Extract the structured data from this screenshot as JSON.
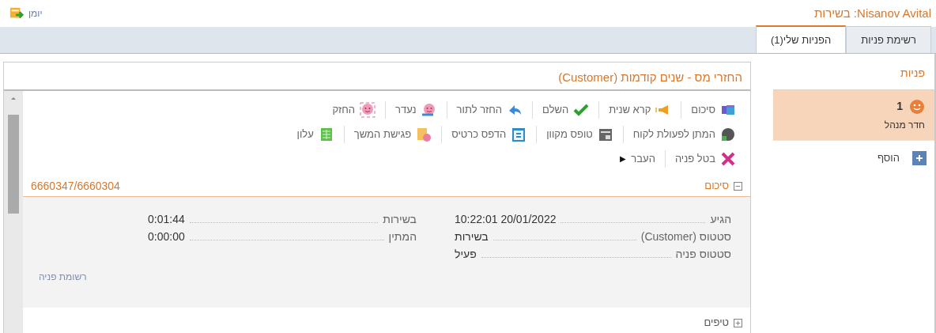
{
  "header": {
    "agent_status": "Nisanov Avital: בשירות",
    "diary_link": "יומן"
  },
  "tabs": [
    {
      "label": "רשימת פניות",
      "selected": false
    },
    {
      "label": "הפניות שלי(1)",
      "selected": true
    }
  ],
  "sidebar": {
    "title": "פניות",
    "items": [
      {
        "count": "1",
        "label": "חדר מנהל",
        "selected": true
      }
    ],
    "add_button": "הוסף"
  },
  "panel": {
    "title": "החזרי מס - שנים קודמות (Customer)",
    "toolbar_rows": [
      [
        {
          "label": "סיכום"
        },
        {
          "label": "קרא שנית"
        },
        {
          "label": "השלם"
        },
        {
          "label": "החזר לתור"
        },
        {
          "label": "נעדר"
        },
        {
          "label": "החזק"
        }
      ],
      [
        {
          "label": "המתן לפעולת לקוח"
        },
        {
          "label": "טופס מקוון"
        },
        {
          "label": "הדפס כרטיס"
        },
        {
          "label": "פגישת המשך"
        },
        {
          "label": "עלון"
        }
      ],
      [
        {
          "label": "בטל פניה"
        },
        {
          "label": "העבר",
          "glyph": "▶"
        }
      ]
    ],
    "sections": [
      {
        "title": "סיכום",
        "expanded": true,
        "reference": "6660347/6660304",
        "fields_right": [
          {
            "label": "הגיע",
            "value": "10:22:01 20/01/2022"
          },
          {
            "label": "סטטוס (Customer)",
            "value": "בשירות"
          },
          {
            "label": "סטטוס פניה",
            "value": "פעיל"
          }
        ],
        "fields_left": [
          {
            "label": "בשירות",
            "value": "0:01:44"
          },
          {
            "label": "המתין",
            "value": "0:00:00"
          }
        ],
        "link": "רשומת פניה"
      },
      {
        "title": "טיפים",
        "expanded": false
      }
    ]
  }
}
